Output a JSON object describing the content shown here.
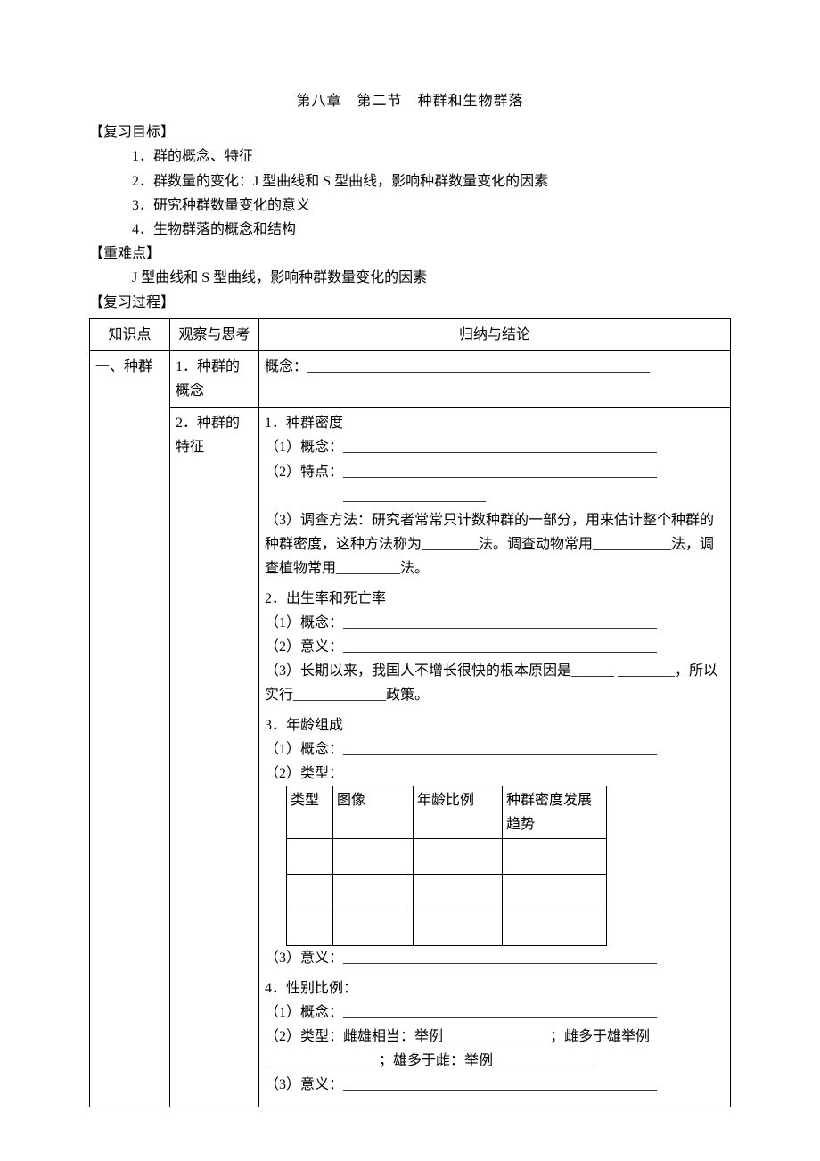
{
  "title": "第八章　第二节　种群和生物群落",
  "sections": {
    "goals_heading": "【复习目标】",
    "goals": [
      "1．群的概念、特征",
      "2．群数量的变化：J 型曲线和 S 型曲线，影响种群数量变化的因素",
      "3．研究种群数量变化的意义",
      "4．生物群落的概念和结构"
    ],
    "keypoints_heading": "【重难点】",
    "keypoints_text": "J 型曲线和 S 型曲线，影响种群数量变化的因素",
    "process_heading": "【复习过程】"
  },
  "table": {
    "headers": {
      "col1": "知识点",
      "col2": "观察与思考",
      "col3": "归纳与结论"
    },
    "row1": {
      "kpoint": "一、种群",
      "obs": "1．种群的概念",
      "concl": "概念：________________________________________________"
    },
    "row2": {
      "obs": "2．种群的特征",
      "density": {
        "title": "1．种群密度",
        "p1": "（1）概念：____________________________________________",
        "p2a": "（2）特点：____________________________________________",
        "p2b": "____________________",
        "p3": "（3）调查方法：研究者常常只计数种群的一部分，用来估计整个种群的种群密度，这种方法称为________法。调查动物常用___________法，调查植物常用_________法。"
      },
      "birth": {
        "title": "2．出生率和死亡率",
        "p1": "（1）概念：____________________________________________",
        "p2": "（2）意义：____________________________________________",
        "p3": "（3）长期以来，我国人不增长很快的根本原因是______ ________，所以实行_____________政策。"
      },
      "age": {
        "title": "3．年龄组成",
        "p1": "（1）概念：____________________________________________",
        "p2": "（2）类型：",
        "inner_headers": {
          "c1": "类型",
          "c2": "图像",
          "c3": "年龄比例",
          "c4": "种群密度发展趋势"
        },
        "p3": "（3）意义：____________________________________________"
      },
      "sex": {
        "title": "4．性别比例：",
        "p1": "（1）概念：____________________________________________",
        "p2": "（2）类型：雌雄相当：举例_______________；雌多于雄举例________________；雄多于雌：举例______________",
        "p3": "（3）意义：____________________________________________"
      }
    }
  }
}
